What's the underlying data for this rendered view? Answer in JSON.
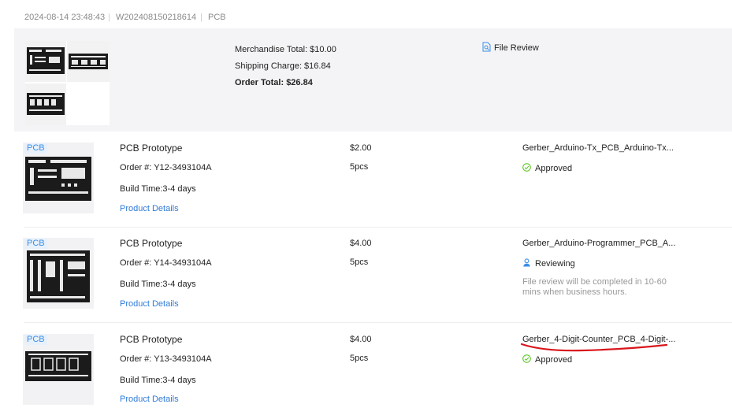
{
  "header": {
    "datetime": "2024-08-14 23:48:43",
    "order_no": "W202408150218614",
    "category": "PCB",
    "separator": "|"
  },
  "summary": {
    "merchandise_total": "Merchandise Total: $10.00",
    "shipping_charge": "Shipping Charge: $16.84",
    "order_total": "Order Total: $26.84",
    "file_review_label": "File Review"
  },
  "items": [
    {
      "tag": "PCB",
      "title": "PCB Prototype",
      "order": "Order #: Y12-3493104A",
      "build_time": "Build Time:3-4 days",
      "details_link": "Product Details",
      "price": "$2.00",
      "qty": "5pcs",
      "file": "Gerber_Arduino-Tx_PCB_Arduino-Tx...",
      "status": "Approved",
      "status_icon": "check-circle-icon",
      "status_color": "#52c41a"
    },
    {
      "tag": "PCB",
      "title": "PCB Prototype",
      "order": "Order #: Y14-3493104A",
      "build_time": "Build Time:3-4 days",
      "details_link": "Product Details",
      "price": "$4.00",
      "qty": "5pcs",
      "file": "Gerber_Arduino-Programmer_PCB_A...",
      "status": "Reviewing",
      "status_icon": "person-icon",
      "status_color": "#3a8ee6",
      "note": "File review will be completed in 10-60 mins when business hours."
    },
    {
      "tag": "PCB",
      "title": "PCB Prototype",
      "order": "Order #: Y13-3493104A",
      "build_time": "Build Time:3-4 days",
      "details_link": "Product Details",
      "price": "$4.00",
      "qty": "5pcs",
      "file": "Gerber_4-Digit-Counter_PCB_4-Digit-...",
      "status": "Approved",
      "status_icon": "check-circle-icon",
      "status_color": "#52c41a"
    }
  ],
  "colors": {
    "link": "#2f7bd8",
    "annotation_underline": "#d9161c",
    "board": "#1b1b1b"
  }
}
